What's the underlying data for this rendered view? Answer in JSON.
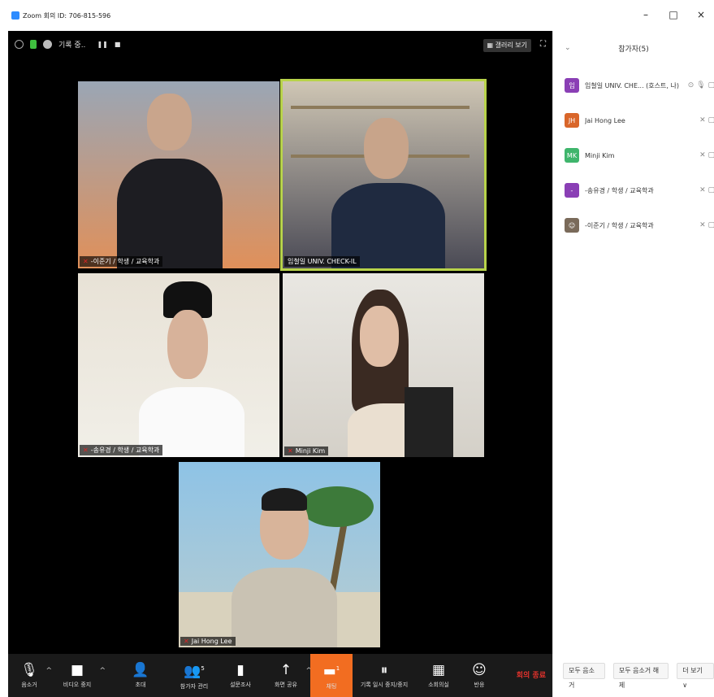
{
  "window": {
    "title": "Zoom 회의 ID: 706-815-596",
    "controls": [
      "–",
      "□",
      "×"
    ]
  },
  "video_top": {
    "recording_label": "기록 중..",
    "gallery_view_label": "갤러리 보기",
    "icons": [
      "info-icon",
      "lock-icon",
      "recording-icon",
      "pause-icon",
      "stop-icon",
      "fullscreen-icon"
    ]
  },
  "tiles": [
    {
      "name": "-이준기 / 학생 / 교육학과",
      "muted": true,
      "active": false,
      "bg_top": "#9aa6b5",
      "bg_bottom": "#e0905a"
    },
    {
      "name": "임철일 UNIV. CHECK-IL",
      "muted": false,
      "active": true,
      "bg_top": "#cfc6b4",
      "bg_bottom": "#4a4a55"
    },
    {
      "name": "-송유경 / 학생 / 교육학과",
      "muted": true,
      "active": false,
      "bg_top": "#e8e2d6",
      "bg_bottom": "#f1efe8"
    },
    {
      "name": "Minji Kim",
      "muted": true,
      "active": false,
      "bg_top": "#e9e7e2",
      "bg_bottom": "#d4d0c8"
    },
    {
      "name": "Jai Hong Lee",
      "muted": true,
      "active": false,
      "bg_top": "#8ec3e6",
      "bg_bottom": "#b9cdd0"
    }
  ],
  "toolbar": {
    "buttons": [
      {
        "label": "음소거",
        "icon": "microphone-icon",
        "glyph": "🎙",
        "caret": true
      },
      {
        "label": "비디오 중지",
        "icon": "video-camera-icon",
        "glyph": "■",
        "caret": true
      },
      {
        "label": "초대",
        "icon": "invite-icon",
        "glyph": "👤",
        "caret": false
      },
      {
        "label": "참가자 관리",
        "icon": "participants-icon",
        "glyph": "👥",
        "badge": "5",
        "caret": false
      },
      {
        "label": "설문조사",
        "icon": "polling-icon",
        "glyph": "▮",
        "caret": false
      },
      {
        "label": "화면 공유",
        "icon": "share-screen-icon",
        "glyph": "↑",
        "caret": true
      },
      {
        "label": "채팅",
        "icon": "chat-icon",
        "glyph": "▬",
        "badge": "1",
        "caret": false
      },
      {
        "label": "기록 일시 중지/중지",
        "icon": "record-pause-icon",
        "glyph": "⏸",
        "caret": false
      },
      {
        "label": "소회의실",
        "icon": "breakout-rooms-icon",
        "glyph": "▦",
        "caret": false
      },
      {
        "label": "반응",
        "icon": "reaction-icon",
        "glyph": "☺",
        "caret": false
      }
    ],
    "end_label": "회의 종료"
  },
  "panel": {
    "title": "참가자(5)",
    "participants": [
      {
        "avatar": "임",
        "avatar_color": "#8a3fb5",
        "name": "임철일 UNIV. CHE... (호스트, 나)",
        "icons": "⊙ 🎙 ▢",
        "muted": false
      },
      {
        "avatar": "JH",
        "avatar_color": "#d9662a",
        "name": "Jai Hong Lee",
        "icons": "✕ ▢",
        "muted": true
      },
      {
        "avatar": "MK",
        "avatar_color": "#3fb56c",
        "name": "Minji Kim",
        "icons": "✕ ▢",
        "muted": true
      },
      {
        "avatar": "-",
        "avatar_color": "#8a3fb5",
        "name": "-송유경 / 학생 / 교육학과",
        "icons": "✕ ▢",
        "muted": true
      },
      {
        "avatar": "☺",
        "avatar_color": "#7a6a5a",
        "name": "-이준기 / 학생 / 교육학과",
        "icons": "✕ ▢",
        "muted": true
      }
    ],
    "footer": {
      "mute_all": "모두 음소거",
      "unmute_all": "모두 음소거 해제",
      "more": "더 보기 ∨"
    }
  }
}
